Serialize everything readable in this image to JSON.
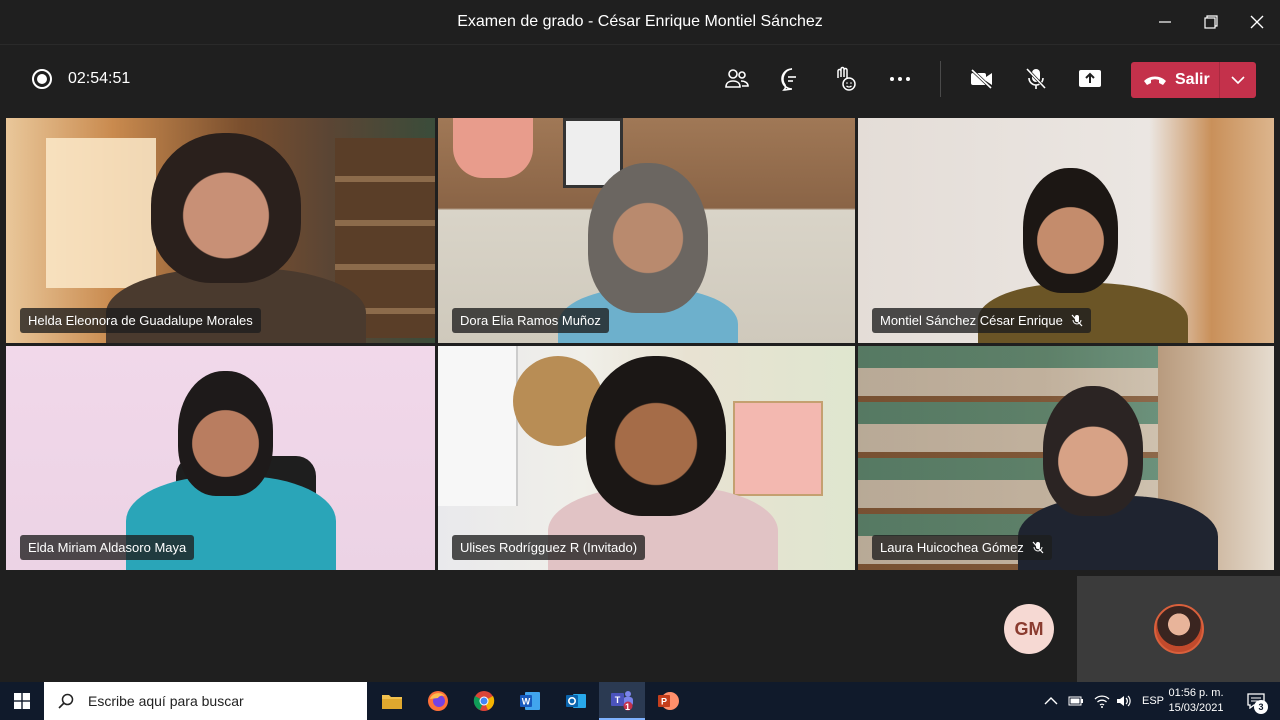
{
  "window": {
    "title": "Examen de grado - César Enrique Montiel Sánchez"
  },
  "toolbar": {
    "timer": "02:54:51",
    "leave_label": "Salir"
  },
  "participants": [
    {
      "name": "Helda Eleonora de Guadalupe Morales",
      "muted": false
    },
    {
      "name": "Dora Elia Ramos Muñoz",
      "muted": false
    },
    {
      "name": "Montiel Sánchez César Enrique",
      "muted": true
    },
    {
      "name": "Elda Miriam Aldasoro Maya",
      "muted": false
    },
    {
      "name": "Ulises Rodrígguez R (Invitado)",
      "muted": false
    },
    {
      "name": "Laura Huicochea Gómez",
      "muted": true
    }
  ],
  "avatar_initials": "GM",
  "taskbar": {
    "search_placeholder": "Escribe aquí para buscar",
    "language": "ESP",
    "time": "01:56 p. m.",
    "date": "15/03/2021",
    "notification_count": "3",
    "teams_badge": "1"
  },
  "colors": {
    "leave_red": "#c4314b",
    "app_bg": "#1f1f1f",
    "taskbar_bg": "#101a2b"
  }
}
